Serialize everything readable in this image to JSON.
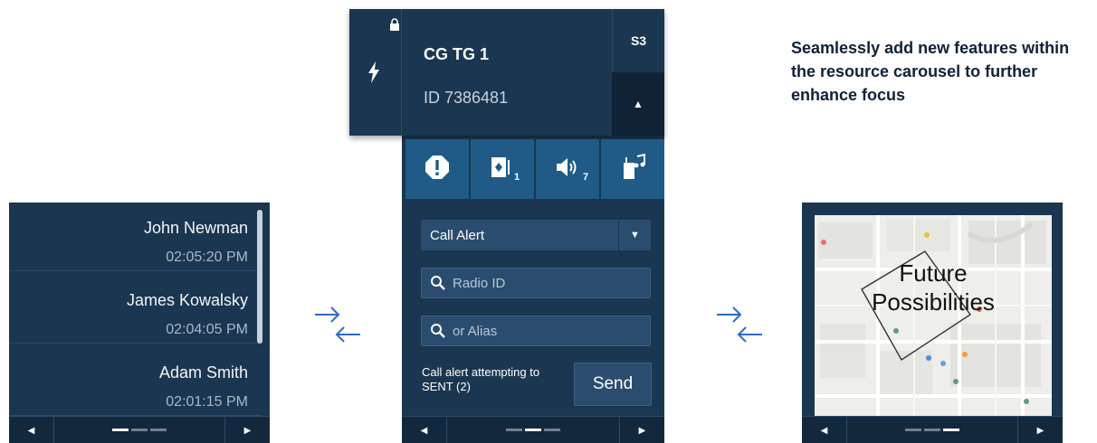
{
  "left_panel": {
    "items": [
      {
        "name": "John Newman",
        "time": "02:05:20 PM"
      },
      {
        "name": "James Kowalsky",
        "time": "02:04:05 PM"
      },
      {
        "name": "Adam Smith",
        "time": "02:01:15 PM"
      }
    ],
    "nav": {
      "left_icon": "left-arrow-icon",
      "right_icon": "right-arrow-icon",
      "active_page": 1,
      "page_count": 3
    }
  },
  "center_panel": {
    "header": {
      "title": "CG TG 1",
      "id_label": "ID 7386481",
      "slot": "S3",
      "lock_icon": "lock-icon",
      "bolt_icon": "lightning-bolt-icon",
      "collapse_icon": "chevron-up-icon"
    },
    "action_icons": [
      {
        "icon": "alert-icon",
        "badge": ""
      },
      {
        "icon": "radio-card-icon",
        "badge": "1"
      },
      {
        "icon": "volume-icon",
        "badge": "7"
      },
      {
        "icon": "radio-music-icon",
        "badge": ""
      }
    ],
    "dropdown": {
      "selected": "Call Alert",
      "icon": "caret-down-icon"
    },
    "radio_id_field": {
      "placeholder": "Radio ID",
      "value": ""
    },
    "alias_field": {
      "placeholder": "or Alias",
      "value": ""
    },
    "status": "Call alert attempting to SENT (2)",
    "send_label": "Send",
    "nav": {
      "active_page": 2,
      "page_count": 3
    }
  },
  "feature_text": "Seamlessly add new features within the resource carousel to further enhance focus",
  "right_panel": {
    "overlay_title_line1": "Future",
    "overlay_title_line2": "Possibilities",
    "nav": {
      "active_page": 3,
      "page_count": 3
    }
  },
  "colors": {
    "panel_bg": "#1b3650",
    "panel_dark": "#14283d",
    "icon_button": "#1f5b86",
    "field_bg": "#2a4d6f",
    "arrow_blue": "#2b6cc4",
    "heading_text": "#0f2236"
  }
}
